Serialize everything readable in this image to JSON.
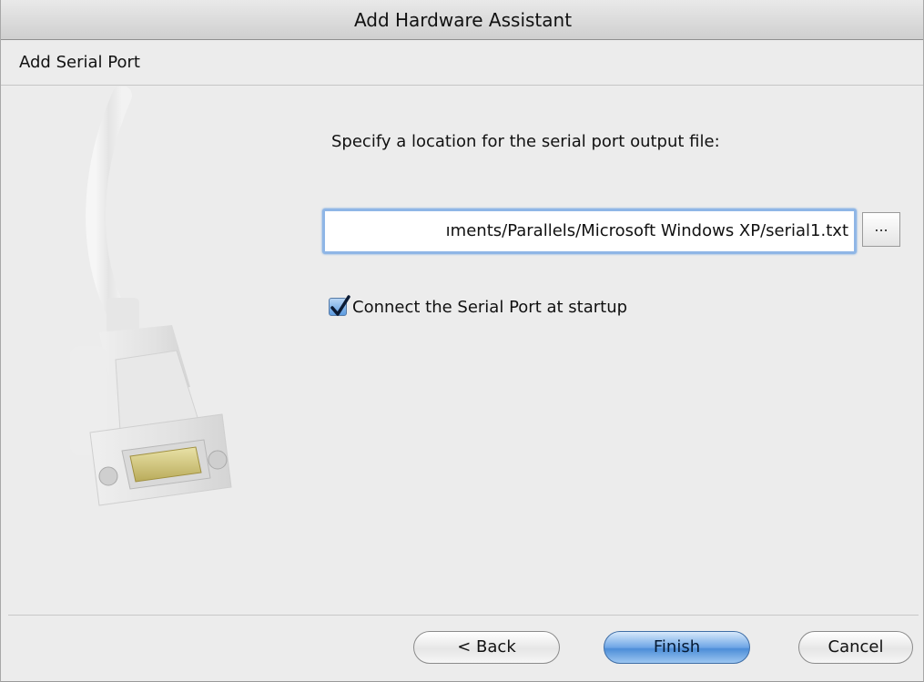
{
  "window": {
    "title": "Add Hardware Assistant"
  },
  "page": {
    "heading": "Add Serial Port",
    "instruction": "Specify a location for the serial port output file:"
  },
  "path_field": {
    "value": "ıments/Parallels/Microsoft Windows XP/serial1.txt",
    "browse_label": "..."
  },
  "startup_option": {
    "label": "Connect the Serial Port at startup",
    "checked": true
  },
  "buttons": {
    "back": "< Back",
    "finish": "Finish",
    "cancel": "Cancel"
  },
  "illustration": {
    "icon": "serial-cable-icon"
  },
  "colors": {
    "accent": "#5c9be0",
    "focus_ring": "#8fb6e6"
  }
}
